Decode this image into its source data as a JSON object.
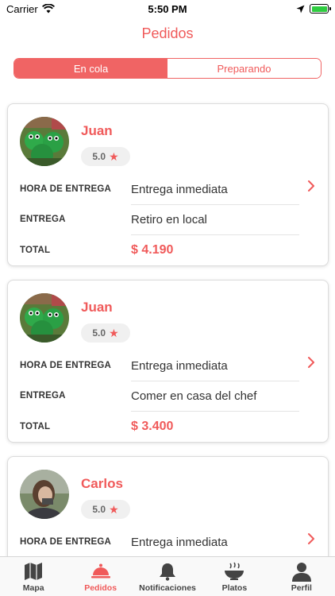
{
  "status_bar": {
    "carrier": "Carrier",
    "time": "5:50 PM"
  },
  "nav": {
    "title": "Pedidos"
  },
  "segments": {
    "active": "En cola",
    "inactive": "Preparando"
  },
  "row_labels": {
    "delivery_time": "HORA DE ENTREGA",
    "delivery": "ENTREGA",
    "total": "TOTAL"
  },
  "orders": [
    {
      "name": "Juan",
      "rating": "5.0",
      "delivery_time": "Entrega inmediata",
      "delivery": "Retiro en local",
      "total": "$ 4.190",
      "avatar": "frog-avatar"
    },
    {
      "name": "Juan",
      "rating": "5.0",
      "delivery_time": "Entrega inmediata",
      "delivery": "Comer en casa del chef",
      "total": "$ 3.400",
      "avatar": "frog-avatar"
    },
    {
      "name": "Carlos",
      "rating": "5.0",
      "delivery_time": "Entrega inmediata",
      "delivery": "",
      "total": "",
      "avatar": "person-avatar"
    }
  ],
  "tabs": [
    {
      "label": "Mapa",
      "icon": "map-icon",
      "active": false
    },
    {
      "label": "Pedidos",
      "icon": "cloche-icon",
      "active": true
    },
    {
      "label": "Notificaciones",
      "icon": "bell-icon",
      "active": false
    },
    {
      "label": "Platos",
      "icon": "bowl-icon",
      "active": false
    },
    {
      "label": "Perfil",
      "icon": "user-icon",
      "active": false
    }
  ],
  "colors": {
    "accent": "#f05a5a",
    "segment": "#f06464",
    "battery": "#2ecc40"
  }
}
